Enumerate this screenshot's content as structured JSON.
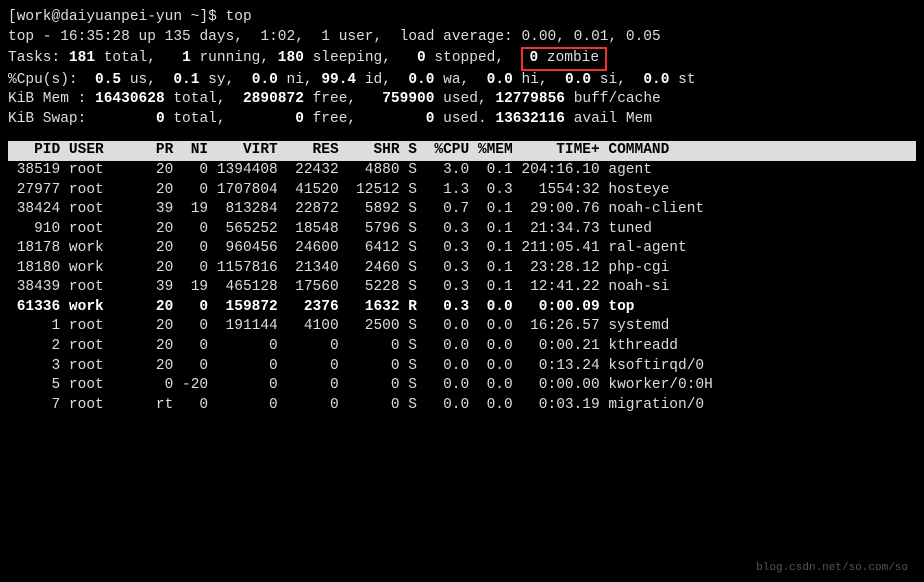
{
  "prompt": "[work@daiyuanpei-yun ~]$ top",
  "summary": {
    "line1_pre": "top - ",
    "time": "16:35:28",
    "up_label": " up ",
    "uptime": "135 days,  1:02",
    "users": "1 user",
    "load_label": "load average:",
    "load": "0.00, 0.01, 0.05"
  },
  "tasks": {
    "label": "Tasks:",
    "total": "181",
    "total_suffix": " total,",
    "running": "1",
    "running_suffix": " running,",
    "sleeping": "180",
    "sleeping_suffix": " sleeping,",
    "stopped": "0",
    "stopped_suffix": " stopped,",
    "zombie": "0",
    "zombie_suffix": " zombie"
  },
  "cpu": {
    "label": "%Cpu(s):",
    "us": "0.5",
    "us_suf": " us,",
    "sy": "0.1",
    "sy_suf": " sy,",
    "ni": "0.0",
    "ni_suf": " ni,",
    "id": "99.4",
    "id_suf": " id,",
    "wa": "0.0",
    "wa_suf": " wa,",
    "hi": "0.0",
    "hi_suf": " hi,",
    "si": "0.0",
    "si_suf": " si,",
    "st": "0.0",
    "st_suf": " st"
  },
  "mem": {
    "label": "KiB Mem :",
    "total": "16430628",
    "total_suf": " total,",
    "free": "2890872",
    "free_suf": " free,",
    "used": "759900",
    "used_suf": " used,",
    "buff": "12779856",
    "buff_suf": " buff/cache"
  },
  "swap": {
    "label": "KiB Swap:",
    "total": "0",
    "total_suf": " total,",
    "free": "0",
    "free_suf": " free,",
    "used": "0",
    "used_suf": " used.",
    "avail": "13632116",
    "avail_suf": " avail Mem"
  },
  "header": "   PID USER      PR  NI    VIRT    RES    SHR S  %CPU %MEM     TIME+ COMMAND    ",
  "rows": [
    {
      "text": " 38519 root      20   0 1394408  22432   4880 S   3.0  0.1 204:16.10 agent",
      "bold": false
    },
    {
      "text": " 27977 root      20   0 1707804  41520  12512 S   1.3  0.3   1554:32 hosteye",
      "bold": false
    },
    {
      "text": " 38424 root      39  19  813284  22872   5892 S   0.7  0.1  29:00.76 noah-client",
      "bold": false
    },
    {
      "text": "   910 root      20   0  565252  18548   5796 S   0.3  0.1  21:34.73 tuned",
      "bold": false
    },
    {
      "text": " 18178 work      20   0  960456  24600   6412 S   0.3  0.1 211:05.41 ral-agent",
      "bold": false
    },
    {
      "text": " 18180 work      20   0 1157816  21340   2460 S   0.3  0.1  23:28.12 php-cgi",
      "bold": false
    },
    {
      "text": " 38439 root      39  19  465128  17560   5228 S   0.3  0.1  12:41.22 noah-si",
      "bold": false
    },
    {
      "text": " 61336 work      20   0  159872   2376   1632 R   0.3  0.0   0:00.09 top",
      "bold": true
    },
    {
      "text": "     1 root      20   0  191144   4100   2500 S   0.0  0.0  16:26.57 systemd",
      "bold": false
    },
    {
      "text": "     2 root      20   0       0      0      0 S   0.0  0.0   0:00.21 kthreadd",
      "bold": false
    },
    {
      "text": "     3 root      20   0       0      0      0 S   0.0  0.0   0:13.24 ksoftirqd/0",
      "bold": false
    },
    {
      "text": "     5 root       0 -20       0      0      0 S   0.0  0.0   0:00.00 kworker/0:0H",
      "bold": false
    },
    {
      "text": "     7 root      rt   0       0      0      0 S   0.0  0.0   0:03.19 migration/0",
      "bold": false
    }
  ],
  "watermark": "blog.csdn.net/so.com/so"
}
